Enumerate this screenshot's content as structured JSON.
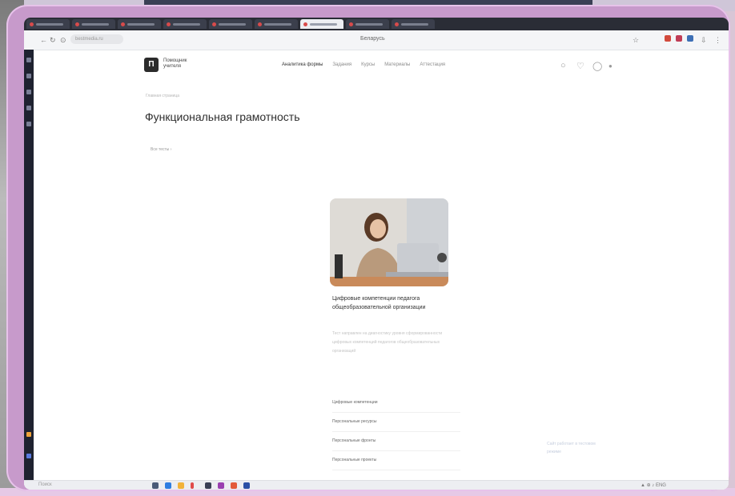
{
  "browser": {
    "tabs_count": 9,
    "active_tab_index": 6,
    "url": "bestmedia.ru",
    "window_title": "Беларусь"
  },
  "site": {
    "logo_letter": "П",
    "logo_text_line1": "Помощник",
    "logo_text_line2": "учителя",
    "nav": [
      "Аналитика формы",
      "Задания",
      "Курсы",
      "Материалы",
      "Аттестация"
    ],
    "active_nav_index": 0
  },
  "page": {
    "breadcrumb": "Главная страница",
    "title": "Функциональная грамотность",
    "filter_label": "Все тесты ›"
  },
  "card": {
    "title": "Цифровые компетенции педагога общеобразовательной организации",
    "description": "Тест направлен на диагностику уровня сформированности цифровых компетенций педагогов общеобразовательных организаций",
    "links": [
      "Цифровые компетенции",
      "Персональные ресурсы",
      "Персональные фронты",
      "Персональные проекты"
    ]
  },
  "corner_note": {
    "line1": "Сайт работает в тестовом",
    "line2": "режиме"
  },
  "taskbar": {
    "search_placeholder": "Поиск",
    "tray": "▲ ⊕ ♪ ENG"
  },
  "colors": {
    "frame": "#c79acb",
    "tab_bar": "#2a2d36",
    "background": "#ffffff"
  }
}
